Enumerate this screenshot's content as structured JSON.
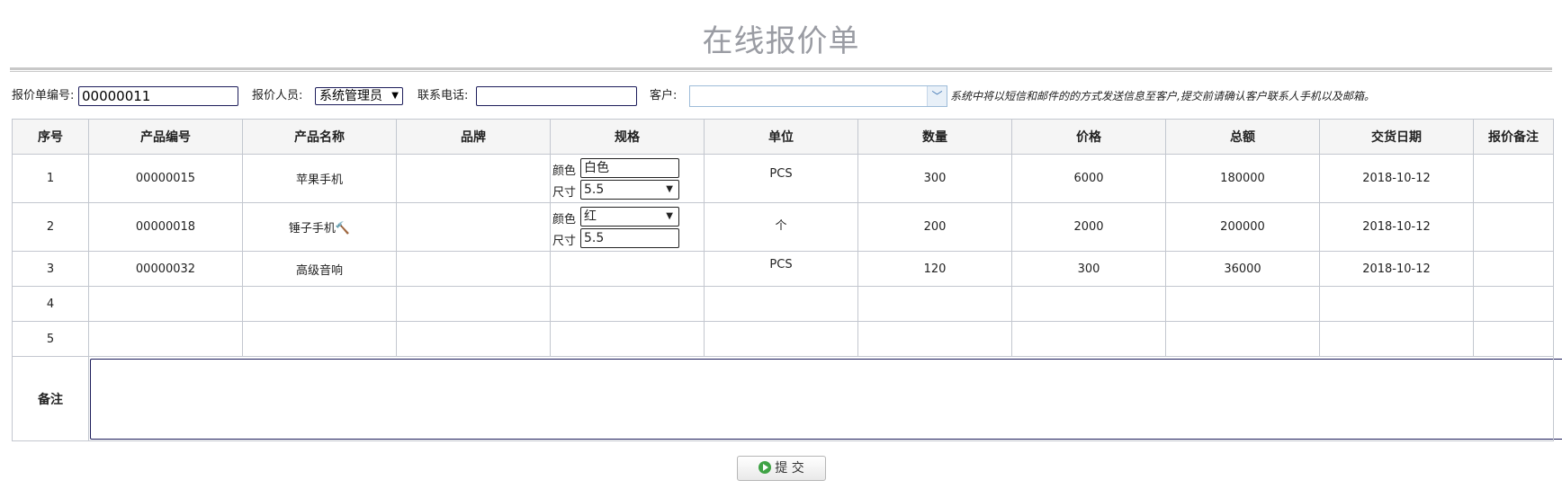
{
  "title": "在线报价单",
  "header": {
    "quote_no_label": "报价单编号:",
    "quote_no_value": "00000011",
    "staff_label": "报价人员:",
    "staff_value": "系统管理员",
    "phone_label": "联系电话:",
    "phone_value": "",
    "customer_label": "客户:",
    "customer_value": "",
    "notice": "系统中将以短信和邮件的的方式发送信息至客户,提交前请确认客户联系人手机以及邮箱。"
  },
  "table": {
    "columns": [
      "序号",
      "产品编号",
      "产品名称",
      "品牌",
      "规格",
      "单位",
      "数量",
      "价格",
      "总额",
      "交货日期",
      "报价备注"
    ],
    "spec_color_label": "颜色",
    "spec_size_label": "尺寸",
    "rows": [
      {
        "no": "1",
        "code": "00000015",
        "name": "苹果手机",
        "brand": "",
        "color": "白色",
        "size": "5.5",
        "unit": "PCS",
        "qty": "300",
        "price": "6000",
        "total": "180000",
        "date": "2018-10-12",
        "remark": ""
      },
      {
        "no": "2",
        "code": "00000018",
        "name": "锤子手机🔨",
        "brand": "",
        "color": "红",
        "size": "5.5",
        "unit": "个",
        "qty": "200",
        "price": "2000",
        "total": "200000",
        "date": "2018-10-12",
        "remark": ""
      },
      {
        "no": "3",
        "code": "00000032",
        "name": "高级音响",
        "brand": "",
        "unit": "PCS",
        "qty": "120",
        "price": "300",
        "total": "36000",
        "date": "2018-10-12",
        "remark": ""
      },
      {
        "no": "4"
      },
      {
        "no": "5"
      }
    ],
    "remark_label": "备注",
    "remark_value": ""
  },
  "submit_label": "提 交"
}
